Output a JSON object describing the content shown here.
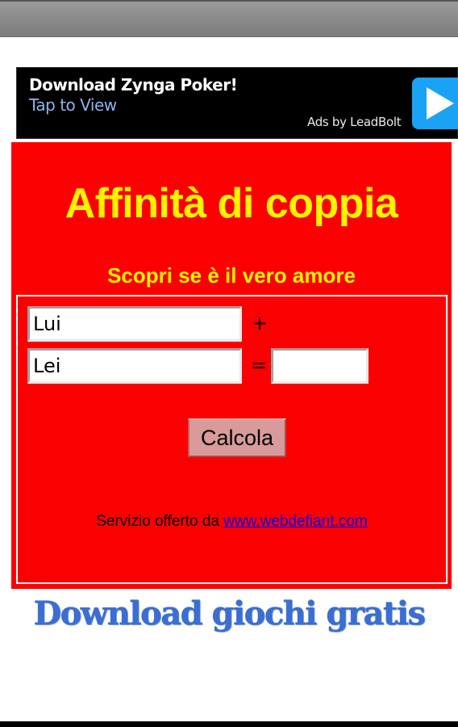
{
  "ad_banner": {
    "title": "Download Zynga Poker!",
    "subtitle": "Tap to View",
    "provider": "Ads by LeadBolt",
    "icon": "play-icon",
    "colors": {
      "background": "#000000",
      "subtitle": "#8fb3ea",
      "play_button": "#1aa3f5"
    }
  },
  "app": {
    "title": "Affinità di coppia",
    "subtitle": "Scopri se è il vero amore",
    "colors": {
      "background": "#fb0000",
      "headline": "#fff200"
    }
  },
  "form": {
    "his_name_value": "Lui",
    "her_name_value": "Lei",
    "plus_sign": "+",
    "equals_sign": "=",
    "result_value": "",
    "calculate_label": "Calcola"
  },
  "footer": {
    "service_text": "Servizio offerto da ",
    "link_text": "www.webdefiant.com"
  },
  "promo": {
    "download_games_label": "Download giochi gratis"
  }
}
